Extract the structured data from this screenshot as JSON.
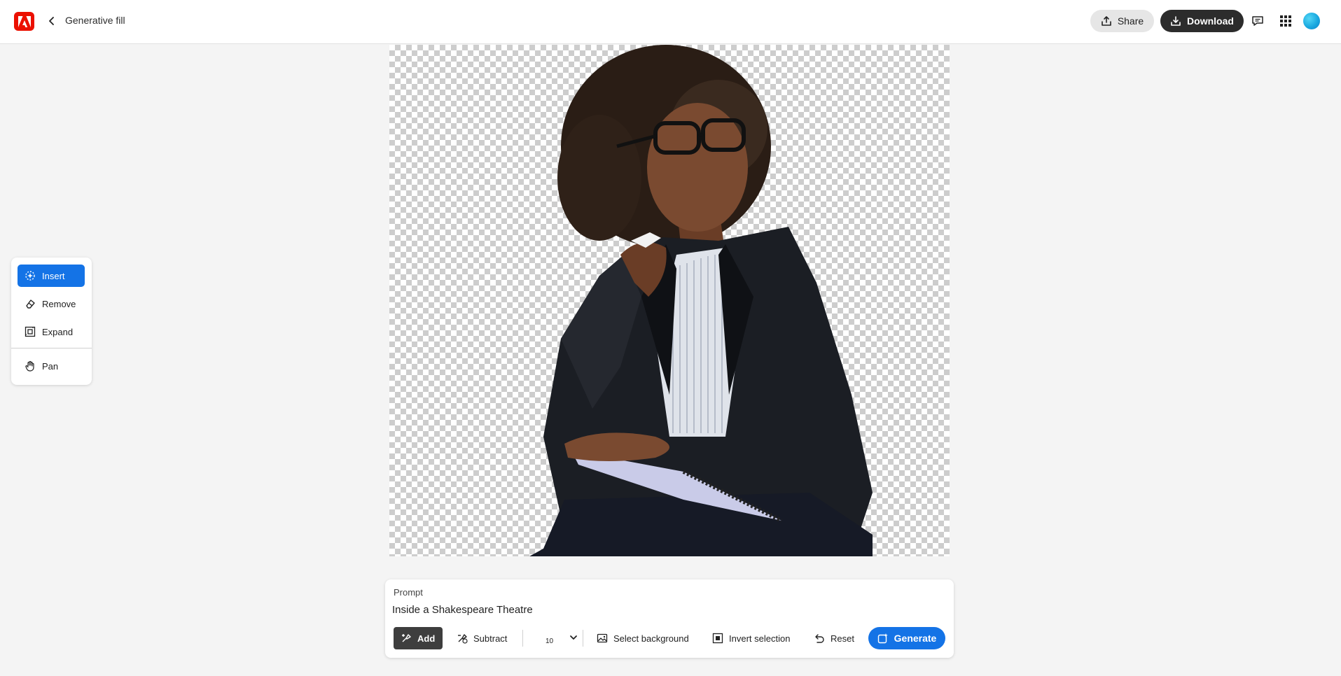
{
  "header": {
    "title": "Generative fill",
    "share_label": "Share",
    "download_label": "Download",
    "icons": [
      "adobe-logo-icon",
      "back-arrow-icon",
      "share-icon",
      "download-icon",
      "comment-icon",
      "apps-grid-icon",
      "avatar"
    ]
  },
  "tools": {
    "items": [
      {
        "label": "Insert",
        "icon": "insert-brush-icon",
        "active": true
      },
      {
        "label": "Remove",
        "icon": "eraser-icon",
        "active": false
      },
      {
        "label": "Expand",
        "icon": "expand-icon",
        "active": false
      },
      {
        "label": "Pan",
        "icon": "hand-icon",
        "active": false
      }
    ]
  },
  "prompt": {
    "label": "Prompt",
    "value": "Inside a Shakespeare Theatre",
    "add_label": "Add",
    "subtract_label": "Subtract",
    "brush_size": "10",
    "select_background_label": "Select background",
    "invert_selection_label": "Invert selection",
    "reset_label": "Reset",
    "generate_label": "Generate"
  },
  "colors": {
    "accent": "#1473e6",
    "brand_red": "#eb1000",
    "dark_button": "#2c2c2c"
  }
}
